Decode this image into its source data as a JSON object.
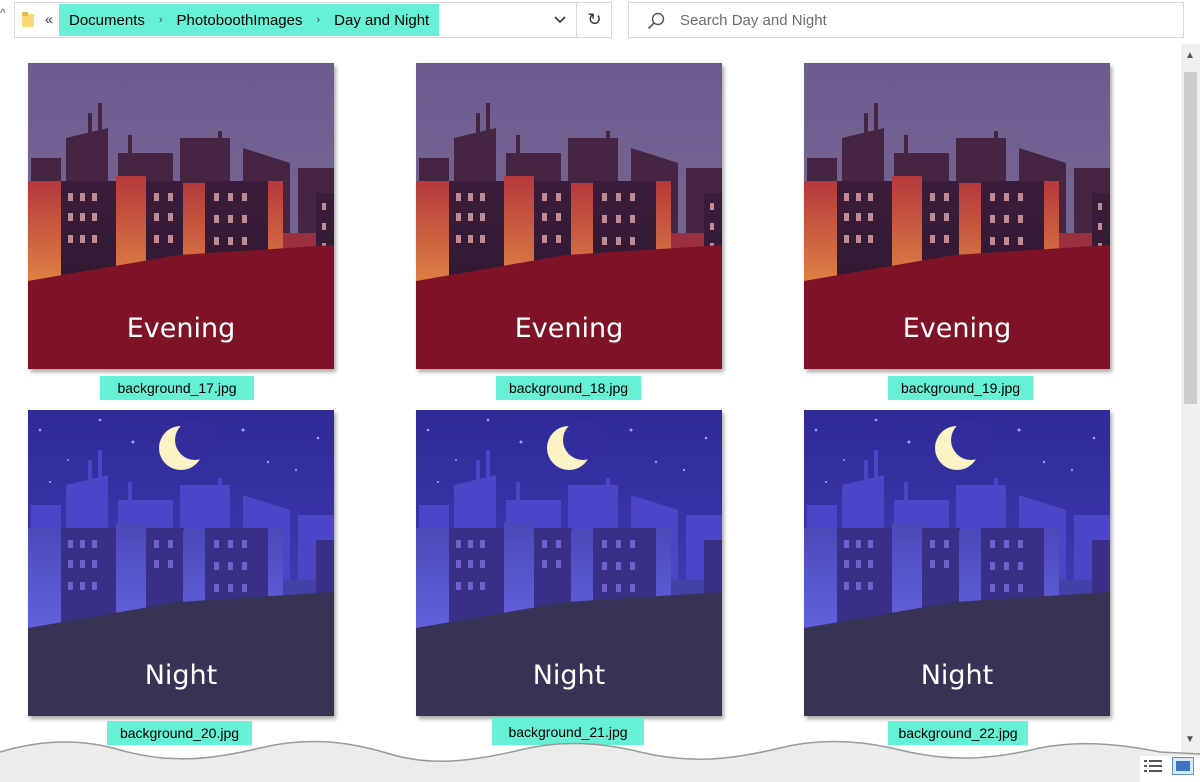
{
  "address_bar": {
    "overflow_label": "«",
    "breadcrumbs": [
      "Documents",
      "PhotoboothImages",
      "Day and Night"
    ]
  },
  "search": {
    "placeholder": "Search Day and Night"
  },
  "files": [
    {
      "name": "background_17.jpg",
      "caption": "Evening",
      "theme": "evening"
    },
    {
      "name": "background_18.jpg",
      "caption": "Evening",
      "theme": "evening"
    },
    {
      "name": "background_19.jpg",
      "caption": "Evening",
      "theme": "evening"
    },
    {
      "name": "background_20.jpg",
      "caption": "Night",
      "theme": "night"
    },
    {
      "name": "background_21.jpg",
      "caption": "Night",
      "theme": "night"
    },
    {
      "name": "background_22.jpg",
      "caption": "Night",
      "theme": "night"
    }
  ],
  "colors": {
    "highlight": "#66f0d6",
    "evening_sky": "#6d5d8c",
    "evening_ground": "#7e1328",
    "night_sky": "#3e33a6",
    "night_ground": "#373355",
    "moon": "#fbf3c5"
  },
  "icons": [
    "folder-icon",
    "chevron-down-icon",
    "refresh-icon",
    "search-icon",
    "scroll-up-icon",
    "scroll-down-icon",
    "details-view-icon",
    "thumbnails-view-icon"
  ]
}
